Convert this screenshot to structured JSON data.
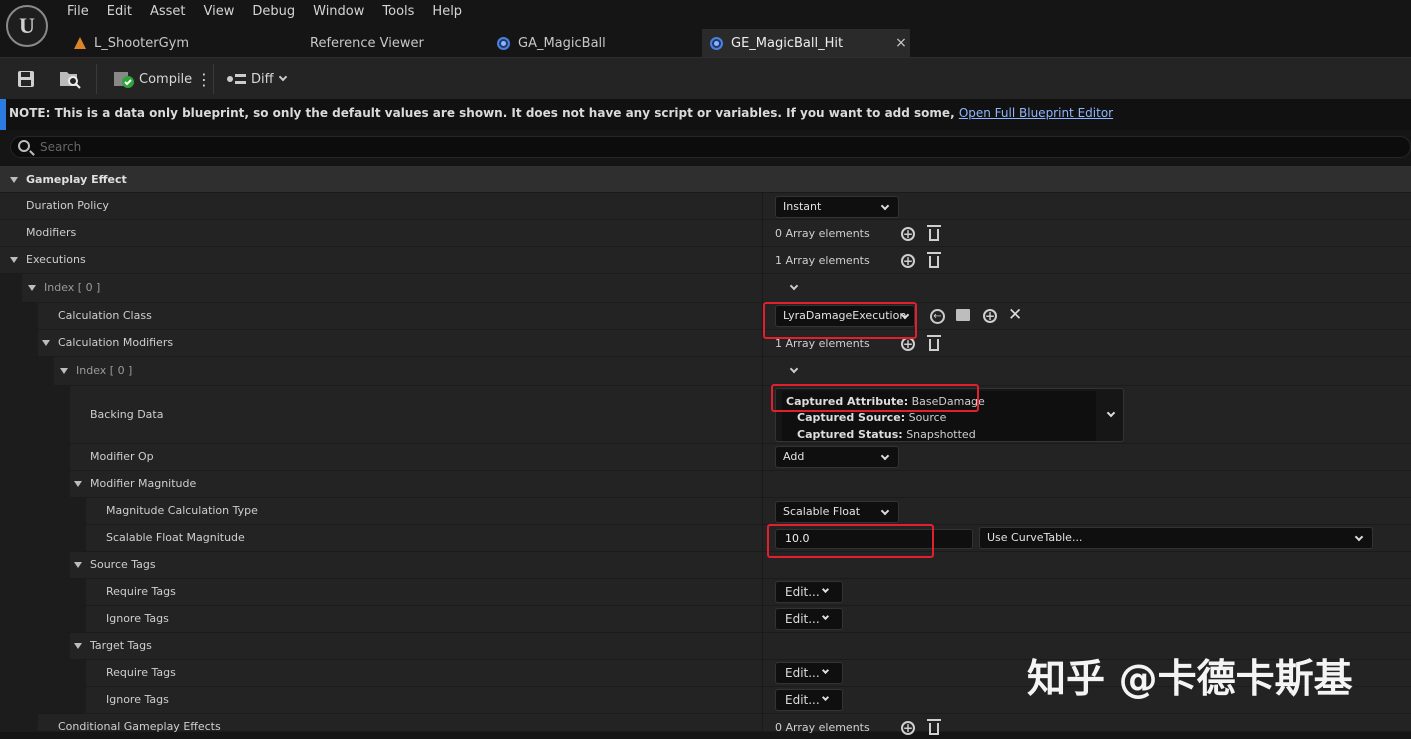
{
  "app": {
    "logo": "U"
  },
  "menu": [
    "File",
    "Edit",
    "Asset",
    "View",
    "Debug",
    "Window",
    "Tools",
    "Help"
  ],
  "tabs": [
    {
      "label": "L_ShooterGym",
      "icon": "level-icon"
    },
    {
      "label": "Reference Viewer",
      "icon": "none"
    },
    {
      "label": "GA_MagicBall",
      "icon": "blueprint-icon"
    },
    {
      "label": "GE_MagicBall_Hit",
      "icon": "blueprint-icon",
      "active": true
    }
  ],
  "tab_close": "×",
  "toolbar": {
    "compile_label": "Compile",
    "more_label": "⋮",
    "diff_label": "Diff"
  },
  "note": {
    "text": "NOTE: This is a data only blueprint, so only the default values are shown.  It does not have any script or variables.  If you want to add some, ",
    "link": "Open Full Blueprint Editor"
  },
  "search": {
    "placeholder": "Search"
  },
  "category": "Gameplay Effect",
  "rows": {
    "duration_policy": {
      "label": "Duration Policy",
      "value": "Instant"
    },
    "modifiers": {
      "label": "Modifiers",
      "value": "0 Array elements"
    },
    "executions": {
      "label": "Executions",
      "value": "1 Array elements"
    },
    "index0": {
      "label": "Index [ 0 ]"
    },
    "calc_class": {
      "label": "Calculation Class",
      "value": "LyraDamageExecution"
    },
    "calc_modifiers": {
      "label": "Calculation Modifiers",
      "value": "1 Array elements"
    },
    "index0b": {
      "label": "Index [ 0 ]"
    },
    "backing_data": {
      "label": "Backing Data",
      "attr_key": "Captured Attribute:",
      "attr_val": "BaseDamage",
      "src_key": "Captured Source:",
      "src_val": "Source",
      "status_key": "Captured Status:",
      "status_val": "Snapshotted"
    },
    "modifier_op": {
      "label": "Modifier Op",
      "value": "Add"
    },
    "modifier_magnitude": {
      "label": "Modifier Magnitude"
    },
    "mag_calc_type": {
      "label": "Magnitude Calculation Type",
      "value": "Scalable Float"
    },
    "scalable_float": {
      "label": "Scalable Float Magnitude",
      "value": "10.0",
      "curve": "Use CurveTable..."
    },
    "source_tags": {
      "label": "Source Tags"
    },
    "src_require": {
      "label": "Require Tags",
      "value": "Edit..."
    },
    "src_ignore": {
      "label": "Ignore Tags",
      "value": "Edit..."
    },
    "target_tags": {
      "label": "Target Tags"
    },
    "tgt_require": {
      "label": "Require Tags",
      "value": "Edit..."
    },
    "tgt_ignore": {
      "label": "Ignore Tags",
      "value": "Edit..."
    },
    "conditional": {
      "label": "Conditional Gameplay Effects",
      "value": "0 Array elements"
    }
  },
  "watermark": "知乎 @卡德卡斯基",
  "colors": {
    "highlight": "#e0202c",
    "accent": "#2b7be0",
    "link": "#8fb6ff"
  }
}
